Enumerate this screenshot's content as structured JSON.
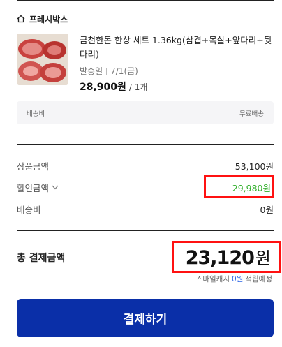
{
  "store": {
    "name": "프레시박스",
    "icon": "home-icon"
  },
  "product": {
    "title": "금천한돈 한상 세트 1.36kg(삼겹+목살+앞다리+뒷다리)",
    "ship_label": "발송일",
    "ship_date": "7/1(금)",
    "price": "28,900원",
    "quantity": "/ 1개"
  },
  "shipping_fee": {
    "label": "배송비",
    "value": "무료배송"
  },
  "summary": {
    "product_amount_label": "상품금액",
    "product_amount": "53,100원",
    "discount_label": "할인금액",
    "discount_amount": "-29,980원",
    "delivery_label": "배송비",
    "delivery_amount": "0원"
  },
  "total": {
    "label": "총 결제금액",
    "amount": "23,120",
    "unit": "원",
    "cash_prefix": "스마일캐시",
    "cash_amount": "0원",
    "cash_suffix": "적립예정"
  },
  "pay_button": {
    "label": "결제하기"
  },
  "colors": {
    "accent": "#0a2fa8",
    "discount": "#2fae29",
    "highlight": "#ff1111",
    "cash": "#2a63e6"
  }
}
